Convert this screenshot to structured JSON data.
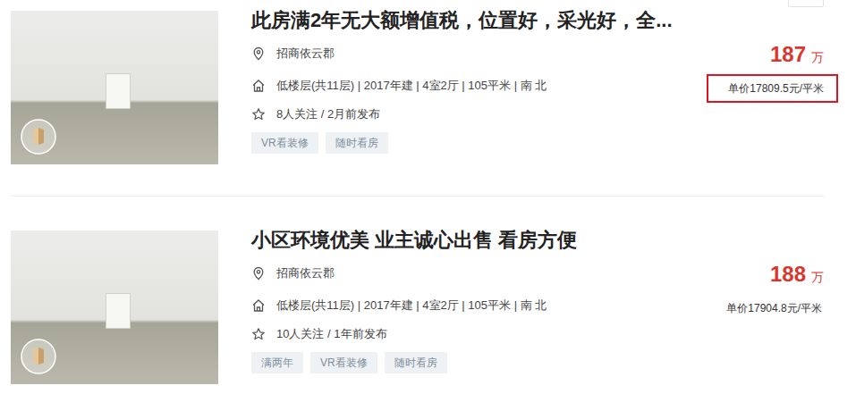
{
  "listings": [
    {
      "title": "此房满2年无大额增值税，位置好，采光好，全...",
      "location": "招商依云郡",
      "info": "低楼层(共11层) | 2017年建 | 4室2厅 | 105平米 | 南 北",
      "follows": "8人关注 / 2月前发布",
      "tags": [
        "VR看装修",
        "随时看房"
      ],
      "price": "187",
      "price_unit": "万",
      "unit_price": "单价17809.5元/平米",
      "highlighted": true
    },
    {
      "title": "小区环境优美 业主诚心出售 看房方便",
      "location": "招商依云郡",
      "info": "低楼层(共11层) | 2017年建 | 4室2厅 | 105平米 | 南 北",
      "follows": "10人关注 / 1年前发布",
      "tags": [
        "满两年",
        "VR看装修",
        "随时看房"
      ],
      "price": "188",
      "price_unit": "万",
      "unit_price": "单价17904.8元/平米",
      "highlighted": false
    }
  ]
}
